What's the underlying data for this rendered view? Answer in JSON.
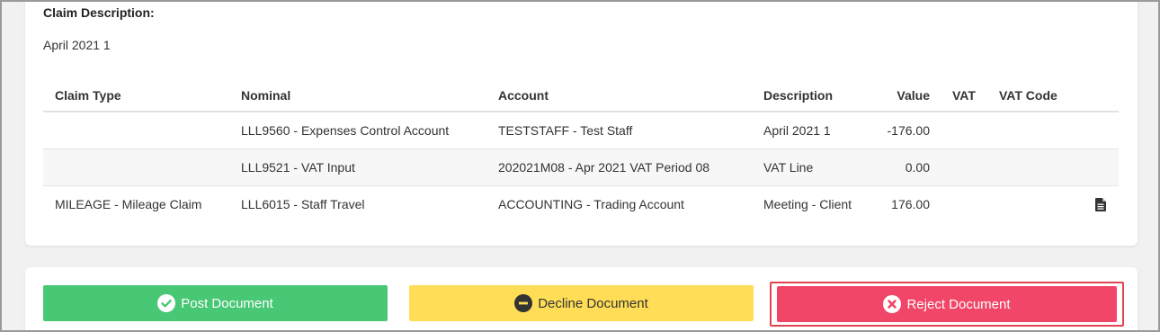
{
  "claim": {
    "description_label": "Claim Description:",
    "description_value": "April 2021 1"
  },
  "table": {
    "headers": {
      "claim_type": "Claim Type",
      "nominal": "Nominal",
      "account": "Account",
      "description": "Description",
      "value": "Value",
      "vat": "VAT",
      "vat_code": "VAT Code"
    },
    "rows": [
      {
        "claim_type": "",
        "nominal": "LLL9560 - Expenses Control Account",
        "account": "TESTSTAFF - Test Staff",
        "description": "April 2021 1",
        "value": "-176.00",
        "vat": "",
        "vat_code": ""
      },
      {
        "claim_type": "",
        "nominal": "LLL9521 - VAT Input",
        "account": "202021M08 - Apr 2021 VAT Period 08",
        "description": "VAT Line",
        "value": "0.00",
        "vat": "",
        "vat_code": ""
      },
      {
        "claim_type": "MILEAGE - Mileage Claim",
        "nominal": "LLL6015 - Staff Travel",
        "account": "ACCOUNTING - Trading Account",
        "description": "Meeting - Client",
        "value": "176.00",
        "vat": "",
        "vat_code": "",
        "icon": "document-icon"
      }
    ]
  },
  "actions": {
    "post_label": "Post Document",
    "decline_label": "Decline Document",
    "reject_label": "Reject Document",
    "post_icon": "check-circle-icon",
    "decline_icon": "minus-circle-icon",
    "reject_icon": "times-circle-icon"
  },
  "colors": {
    "post": "#48c774",
    "decline": "#ffdd57",
    "reject": "#f14668",
    "reject_highlight": "#e0444f"
  }
}
